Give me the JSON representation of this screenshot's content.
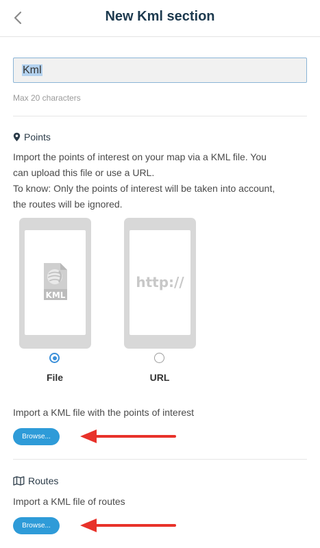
{
  "header": {
    "title": "New Kml section",
    "back_icon": "chevron-left-icon"
  },
  "name_field": {
    "value": "Kml",
    "hint": "Max 20 characters"
  },
  "points": {
    "icon": "map-marker-icon",
    "title": "Points",
    "description_lines": [
      "Import the points of interest on your map via a KML file. You",
      "can upload this file or use a URL.",
      "To know: Only the points of interest will be taken into account,",
      "the routes will be ignored."
    ],
    "options": [
      {
        "label": "File",
        "icon": "kml-file-icon",
        "selected": true
      },
      {
        "label": "URL",
        "screen_text": "http://",
        "selected": false
      }
    ],
    "import_label": "Import a KML file with the points of interest",
    "browse_label": "Browse..."
  },
  "routes": {
    "icon": "map-icon",
    "title": "Routes",
    "import_label": "Import a KML file of routes",
    "browse_label": "Browse..."
  },
  "colors": {
    "accent": "#2e9bd8",
    "arrow": "#e8322a",
    "title": "#1d3a4f"
  }
}
